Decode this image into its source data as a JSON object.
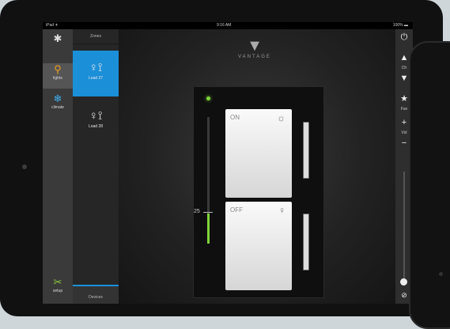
{
  "status": {
    "carrier": "iPad ✈",
    "time": "9:16 AM",
    "battery": "100% ▬"
  },
  "nav": {
    "lights_label": "lights",
    "climate_label": "climate",
    "setup_label": "setup"
  },
  "zones": {
    "header": "Zones",
    "items": [
      {
        "label": "Load 27",
        "selected": true
      },
      {
        "label": "Load 28",
        "selected": false
      }
    ],
    "devices_tab": "Devices"
  },
  "brand": {
    "logo_text": "VANTAGE"
  },
  "switch": {
    "on_label": "ON",
    "off_label": "OFF",
    "level_value": "25"
  },
  "controls": {
    "ch_label": "Ch",
    "fav_label": "Fav",
    "vol_label": "Vol"
  },
  "colors": {
    "accent": "#1b8fd8",
    "led": "#7fd43a"
  }
}
